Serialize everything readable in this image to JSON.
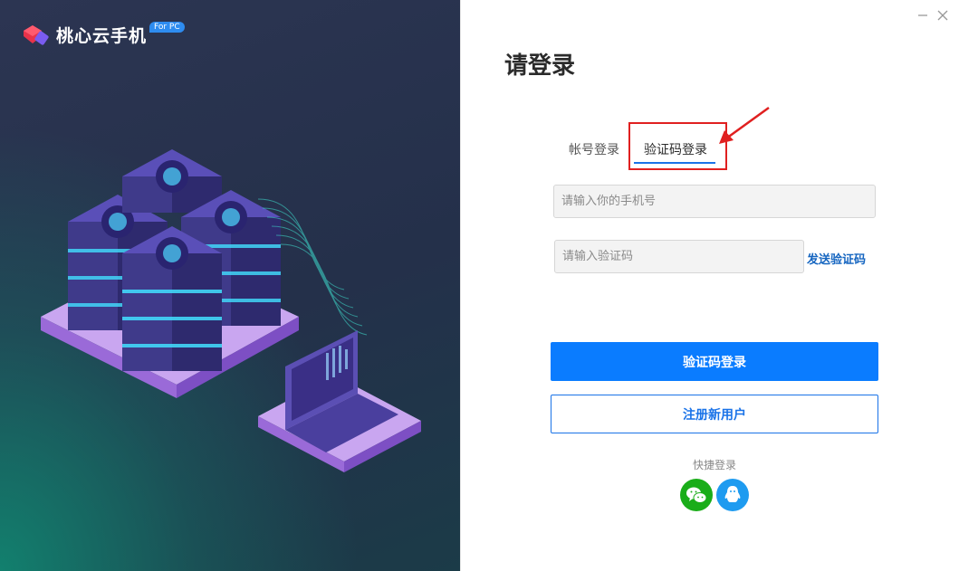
{
  "brand": {
    "name": "桃心云手机",
    "badge": "For PC"
  },
  "window": {
    "minimize_icon": "minimize-icon",
    "close_icon": "close-icon"
  },
  "login": {
    "title": "请登录",
    "tabs": [
      {
        "label": "帐号登录",
        "active": false
      },
      {
        "label": "验证码登录",
        "active": true
      }
    ],
    "phone_placeholder": "请输入你的手机号",
    "code_placeholder": "请输入验证码",
    "send_code_label": "发送验证码",
    "submit_label": "验证码登录",
    "register_label": "注册新用户",
    "quick_login_label": "快捷登录",
    "quick_login_icons": [
      "wechat-icon",
      "qq-icon"
    ]
  },
  "colors": {
    "primary": "#0a7cff",
    "link": "#1565c0",
    "highlight": "#e02020",
    "wechat": "#1aad19",
    "qq": "#1e9bf0"
  }
}
